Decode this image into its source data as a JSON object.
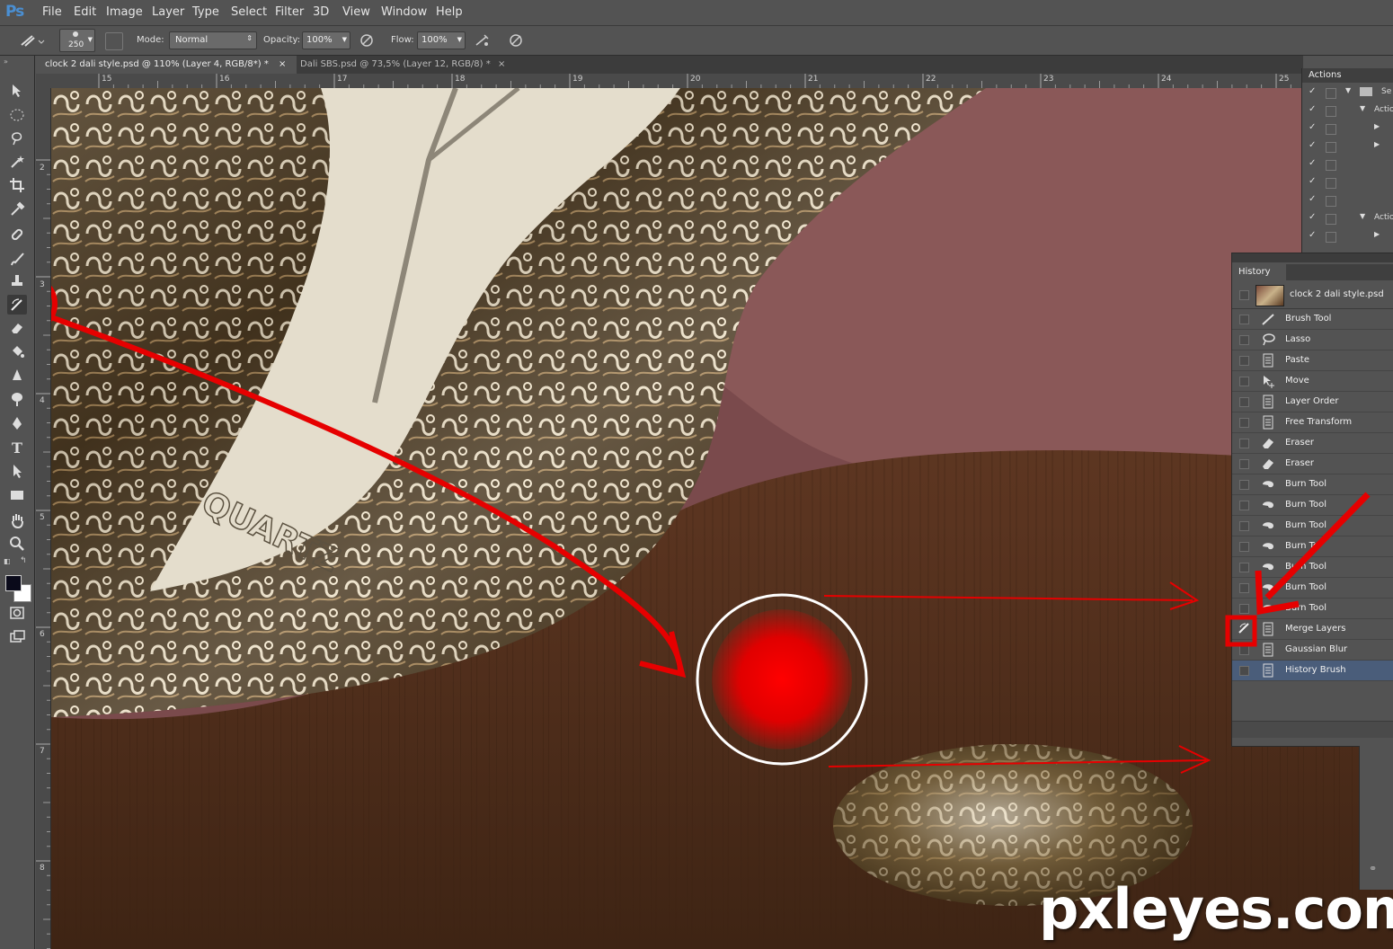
{
  "app": {
    "logo": "Ps"
  },
  "menu": [
    "File",
    "Edit",
    "Image",
    "Layer",
    "Type",
    "Select",
    "Filter",
    "3D",
    "View",
    "Window",
    "Help"
  ],
  "options": {
    "brush_size": "250",
    "mode_label": "Mode:",
    "mode_value": "Normal",
    "opacity_label": "Opacity:",
    "opacity_value": "100%",
    "flow_label": "Flow:",
    "flow_value": "100%"
  },
  "tabs": [
    {
      "label": "clock 2 dali style.psd @ 110% (Layer 4, RGB/8*) *",
      "active": true
    },
    {
      "label": "Dali SBS.psd @ 73,5% (Layer 12, RGB/8) *",
      "active": false
    }
  ],
  "ruler": {
    "horizontal": [
      "15",
      "16",
      "17",
      "18",
      "19",
      "20",
      "21",
      "22",
      "23",
      "24",
      "25"
    ],
    "vertical": [
      "2",
      "3",
      "4",
      "5",
      "6",
      "7",
      "8"
    ]
  },
  "actions_panel": {
    "title": "Actions",
    "rows": [
      "Se",
      "Actio",
      "",
      "",
      "",
      "",
      "",
      "Actio",
      ""
    ]
  },
  "history_panel": {
    "title": "History",
    "snapshot": "clock 2 dali style.psd",
    "items": [
      {
        "label": "Brush Tool",
        "icon": "brush-icon"
      },
      {
        "label": "Lasso",
        "icon": "lasso-icon"
      },
      {
        "label": "Paste",
        "icon": "document-icon"
      },
      {
        "label": "Move",
        "icon": "move-icon"
      },
      {
        "label": "Layer Order",
        "icon": "document-icon"
      },
      {
        "label": "Free Transform",
        "icon": "document-icon"
      },
      {
        "label": "Eraser",
        "icon": "eraser-icon"
      },
      {
        "label": "Eraser",
        "icon": "eraser-icon"
      },
      {
        "label": "Burn Tool",
        "icon": "burn-icon"
      },
      {
        "label": "Burn Tool",
        "icon": "burn-icon"
      },
      {
        "label": "Burn Tool",
        "icon": "burn-icon"
      },
      {
        "label": "Burn To",
        "icon": "burn-icon"
      },
      {
        "label": "Burn Tool",
        "icon": "burn-icon"
      },
      {
        "label": "Burn Tool",
        "icon": "burn-icon"
      },
      {
        "label": "Burn Tool",
        "icon": "burn-icon"
      },
      {
        "label": "Merge Layers",
        "icon": "document-icon",
        "history_source": true
      },
      {
        "label": "Gaussian Blur",
        "icon": "document-icon"
      },
      {
        "label": "History Brush",
        "icon": "document-icon",
        "selected": true
      }
    ]
  },
  "artwork": {
    "engraving": "QUARTZ"
  },
  "watermark": "pxleyes.com",
  "colors": {
    "ui_bg": "#535353",
    "panel_dark": "#3c3c3c",
    "selected_row": "#4a5d7a",
    "annotation_red": "#e60000",
    "ps_blue": "#4a8fd3"
  }
}
